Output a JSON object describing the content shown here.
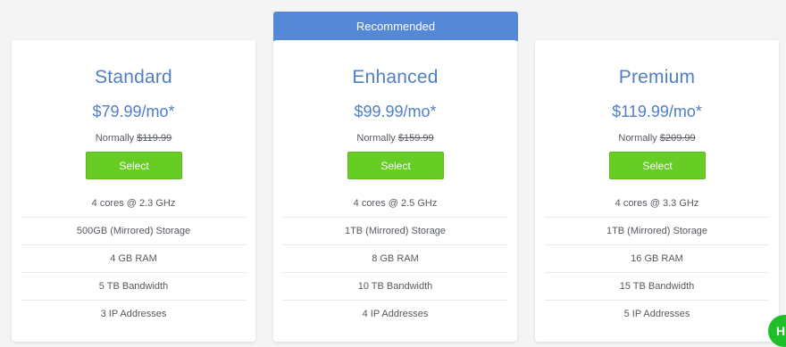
{
  "ribbon": {
    "label": "Recommended"
  },
  "plans": [
    {
      "name": "Standard",
      "price": "$79.99/mo*",
      "normally_label": "Normally",
      "normally_price": "$119.99",
      "select_label": "Select",
      "features": [
        "4 cores @ 2.3 GHz",
        "500GB (Mirrored) Storage",
        "4 GB RAM",
        "5 TB Bandwidth",
        "3 IP Addresses"
      ]
    },
    {
      "name": "Enhanced",
      "price": "$99.99/mo*",
      "normally_label": "Normally",
      "normally_price": "$159.99",
      "select_label": "Select",
      "features": [
        "4 cores @ 2.5 GHz",
        "1TB (Mirrored) Storage",
        "8 GB RAM",
        "10 TB Bandwidth",
        "4 IP Addresses"
      ]
    },
    {
      "name": "Premium",
      "price": "$119.99/mo*",
      "normally_label": "Normally",
      "normally_price": "$209.99",
      "select_label": "Select",
      "features": [
        "4 cores @ 3.3 GHz",
        "1TB (Mirrored) Storage",
        "16 GB RAM",
        "15 TB Bandwidth",
        "5 IP Addresses"
      ]
    }
  ],
  "help_button": {
    "label": "H"
  },
  "colors": {
    "accent_blue": "#4f7fc4",
    "ribbon_blue": "#5588d6",
    "select_green": "#67cc24",
    "help_green": "#1fbf2a"
  }
}
